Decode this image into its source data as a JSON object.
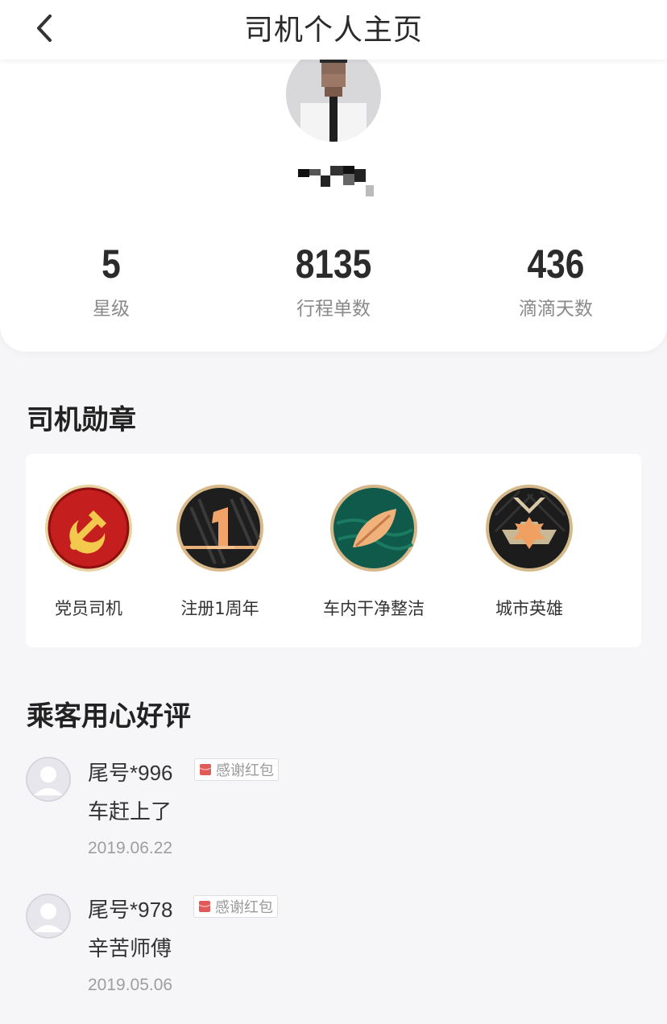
{
  "header": {
    "title": "司机个人主页"
  },
  "profile": {
    "stats": [
      {
        "value": "5",
        "label": "星级"
      },
      {
        "value": "8135",
        "label": "行程单数"
      },
      {
        "value": "436",
        "label": "滴滴天数"
      }
    ]
  },
  "badges_section": {
    "title": "司机勋章",
    "items": [
      {
        "label": "党员司机",
        "icon": "party-emblem-icon"
      },
      {
        "label": "注册1周年",
        "icon": "anniversary-1-icon"
      },
      {
        "label": "车内干净整洁",
        "icon": "leaf-icon"
      },
      {
        "label": "城市英雄",
        "icon": "city-hero-medal-icon"
      }
    ]
  },
  "reviews_section": {
    "title": "乘客用心好评",
    "items": [
      {
        "user": "尾号*996",
        "tag": "感谢红包",
        "text": "车赶上了",
        "date": "2019.06.22"
      },
      {
        "user": "尾号*978",
        "tag": "感谢红包",
        "text": "辛苦师傅",
        "date": "2019.05.06"
      }
    ]
  },
  "colors": {
    "background": "#f6f6f8",
    "card": "#ffffff",
    "tag_icon": "#e05a5a"
  }
}
